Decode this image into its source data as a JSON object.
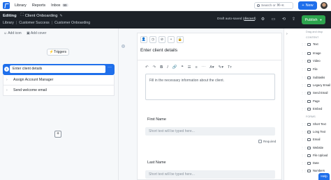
{
  "nav": {
    "links": [
      "Library",
      "Reports",
      "Inbox"
    ],
    "inbox_badge": "99",
    "search_placeholder": "Search or ⌘+K",
    "new_label": "New"
  },
  "toolbar": {
    "editing_label": "Editing",
    "title": "Client Onboarding",
    "breadcrumb": [
      "Library",
      "Customer Success",
      "Customer Onboarding"
    ],
    "draft_text": "Draft auto-saved",
    "discard_label": "discard",
    "publish_label": "Publish"
  },
  "left": {
    "add_icon_label": "Add icon",
    "add_cover_label": "Add cover",
    "triggers_label": "Triggers",
    "steps": [
      {
        "num": "1",
        "label": "Enter client details"
      },
      {
        "label": "Assign Account Manager"
      },
      {
        "label": "Send welcome email"
      }
    ],
    "add_step_symbol": "+"
  },
  "editor": {
    "step_title": "Enter client details",
    "description": "Fill in the necessary information about the client.",
    "fields": [
      {
        "label": "First Name",
        "placeholder": "Short text will be typed here..."
      },
      {
        "label": "Last Name",
        "placeholder": "Short text will be typed here..."
      }
    ],
    "required_label": "Required"
  },
  "right": {
    "drag_hint": "Drag and drop",
    "content_heading": "CONTENT",
    "content_items": [
      "Text",
      "Image",
      "Video",
      "File",
      "Subtasks",
      "Legacy Email",
      "Send Email",
      "Page",
      "Embed"
    ],
    "forms_heading": "FORMS",
    "form_items": [
      "Short Text",
      "Long Text",
      "Email",
      "Website",
      "File Upload",
      "Date",
      "Numbers"
    ],
    "help_label": "Help"
  }
}
